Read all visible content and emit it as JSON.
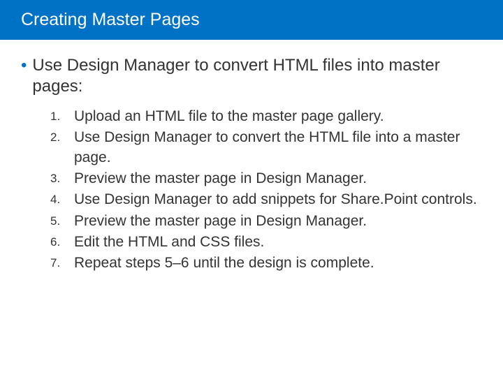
{
  "title": "Creating Master Pages",
  "intro": "Use Design Manager to convert HTML files into master pages:",
  "steps": [
    "Upload an HTML file to the master page gallery.",
    "Use Design Manager to convert the HTML file into a master page.",
    "Preview the master page in Design Manager.",
    "Use Design Manager to add snippets for Share.Point controls.",
    "Preview the master page in Design Manager.",
    "Edit the HTML and CSS files.",
    "Repeat steps 5–6 until the design is complete."
  ]
}
